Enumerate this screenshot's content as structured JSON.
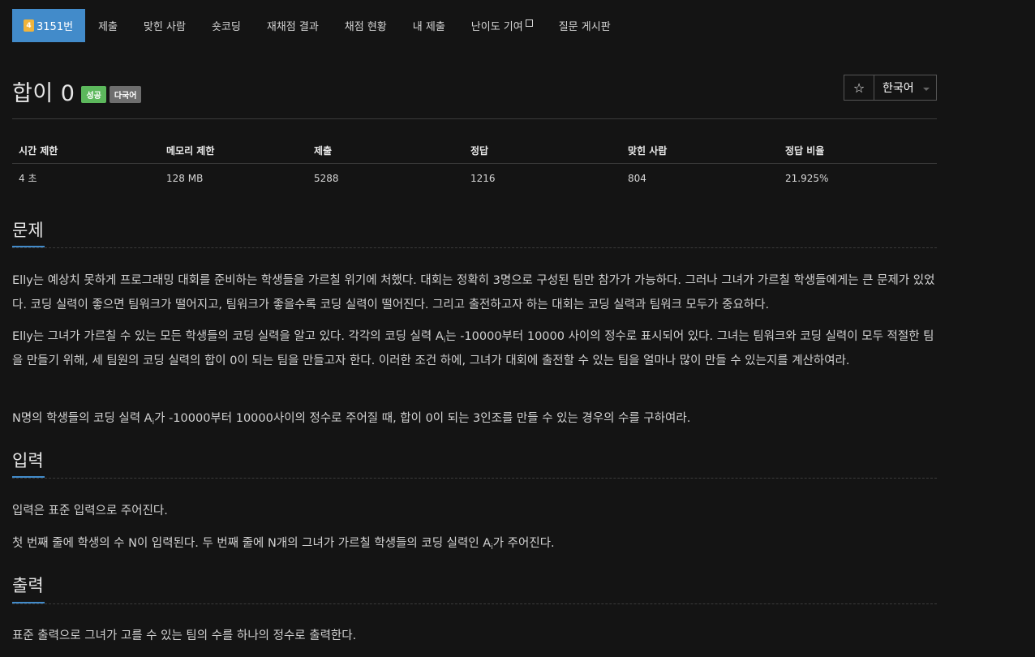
{
  "nav": {
    "tier_badge": "4",
    "problem_number": "3151번",
    "items": [
      "제출",
      "맞힌 사람",
      "숏코딩",
      "재채점 결과",
      "채점 현황",
      "내 제출",
      "난이도 기여",
      "질문 게시판"
    ]
  },
  "title": "합이 0",
  "labels": {
    "success": "성공",
    "multilang": "다국어"
  },
  "star_icon": "☆",
  "language": "한국어",
  "info": {
    "headers": [
      "시간 제한",
      "메모리 제한",
      "제출",
      "정답",
      "맞힌 사람",
      "정답 비율"
    ],
    "values": [
      "4 초",
      "128 MB",
      "5288",
      "1216",
      "804",
      "21.925%"
    ]
  },
  "problem": {
    "title": "문제",
    "p1": "Elly는 예상치 못하게 프로그래밍 대회를 준비하는 학생들을 가르칠 위기에 처했다. 대회는 정확히 3명으로 구성된 팀만 참가가 가능하다. 그러나 그녀가 가르칠 학생들에게는 큰 문제가 있었다. 코딩 실력이 좋으면 팀워크가 떨어지고, 팀워크가 좋을수록 코딩 실력이 떨어진다. 그리고 출전하고자 하는 대회는 코딩 실력과 팀워크 모두가 중요하다.",
    "p2a": "Elly는 그녀가 가르칠 수 있는 모든 학생들의 코딩 실력을 알고 있다. 각각의 코딩 실력 A",
    "p2sub": "i",
    "p2b": "는 -10000부터 10000 사이의 정수로 표시되어 있다. 그녀는 팀워크와 코딩 실력이 모두 적절한 팀을 만들기 위해, 세 팀원의 코딩 실력의 합이 0이 되는 팀을 만들고자 한다. 이러한 조건 하에, 그녀가 대회에 출전할 수 있는 팀을 얼마나 많이 만들 수 있는지를 계산하여라.",
    "p3a": "N명의 학생들의 코딩 실력 A",
    "p3sub": "i",
    "p3b": "가 -10000부터 10000사이의 정수로 주어질 때, 합이 0이 되는 3인조를 만들 수 있는 경우의 수를 구하여라."
  },
  "input": {
    "title": "입력",
    "p1": "입력은 표준 입력으로 주어진다.",
    "p2a": "첫 번째 줄에 학생의 수 N이 입력된다. 두 번째 줄에 N개의 그녀가 가르칠 학생들의 코딩 실력인 A",
    "p2sub": "i",
    "p2b": "가 주어진다."
  },
  "output": {
    "title": "출력",
    "p1": "표준 출력으로 그녀가 고를 수 있는 팀의 수를 하나의 정수로 출력한다."
  }
}
